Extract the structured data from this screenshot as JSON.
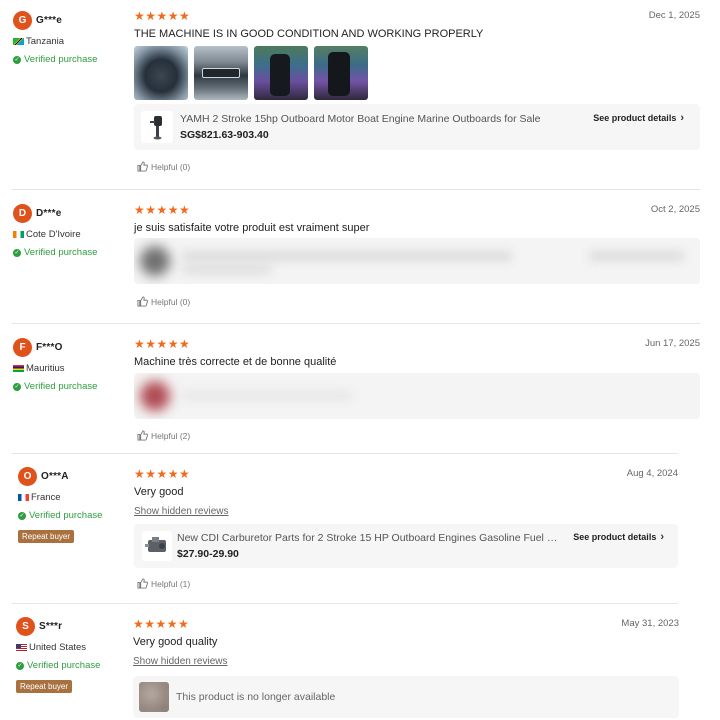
{
  "reviews": [
    {
      "initial": "G",
      "name": "G***e",
      "country": "Tanzania",
      "verified": "Verified purchase",
      "stars": "★★★★★",
      "date": "Dec 1, 2025",
      "text": "THE MACHINE IS IN GOOD CONDITION AND WORKING PROPERLY",
      "product": {
        "title": "YAMH 2 Stroke 15hp Outboard Motor Boat Engine Marine Outboards for Sale",
        "price": "SG$821.63-903.40",
        "details": "See product details"
      },
      "helpful": "Helpful (0)"
    },
    {
      "initial": "D",
      "name": "D***e",
      "country": "Cote D'Ivoire",
      "verified": "Verified purchase",
      "stars": "★★★★★",
      "date": "Oct 2, 2025",
      "text": "je suis satisfaite votre produit est vraiment super",
      "helpful": "Helpful (0)"
    },
    {
      "initial": "F",
      "name": "F***O",
      "country": "Mauritius",
      "verified": "Verified purchase",
      "stars": "★★★★★",
      "date": "Jun 17, 2025",
      "text": "Machine très correcte et de bonne qualité",
      "helpful": "Helpful (2)"
    },
    {
      "initial": "O",
      "name": "O***A",
      "country": "France",
      "verified": "Verified purchase",
      "repeat": "Repeat buyer",
      "stars": "★★★★★",
      "date": "Aug 4, 2024",
      "text": "Very good",
      "hidden_link": "Show hidden reviews",
      "product": {
        "title": "New CDI Carburetor Parts for 2 Stroke 15 HP Outboard Engines Gasoline Fuel Workin...",
        "price": "$27.90-29.90",
        "details": "See product details"
      },
      "helpful": "Helpful (1)"
    },
    {
      "initial": "S",
      "name": "S***r",
      "country": "United States",
      "verified": "Verified purchase",
      "repeat": "Repeat buyer",
      "stars": "★★★★★",
      "date": "May 31, 2023",
      "text": "Very good quality",
      "hidden_link": "Show hidden reviews",
      "unavailable": "This product is no longer available"
    }
  ],
  "colors": {
    "accent": "#f06b1e",
    "avatar": "#e0521c",
    "verified": "#2e9d3f",
    "repeat_badge": "#a8713f"
  },
  "icons": {
    "verified": "check-circle-icon",
    "helpful": "thumbs-up-icon",
    "chevron": "chevron-right-icon"
  }
}
